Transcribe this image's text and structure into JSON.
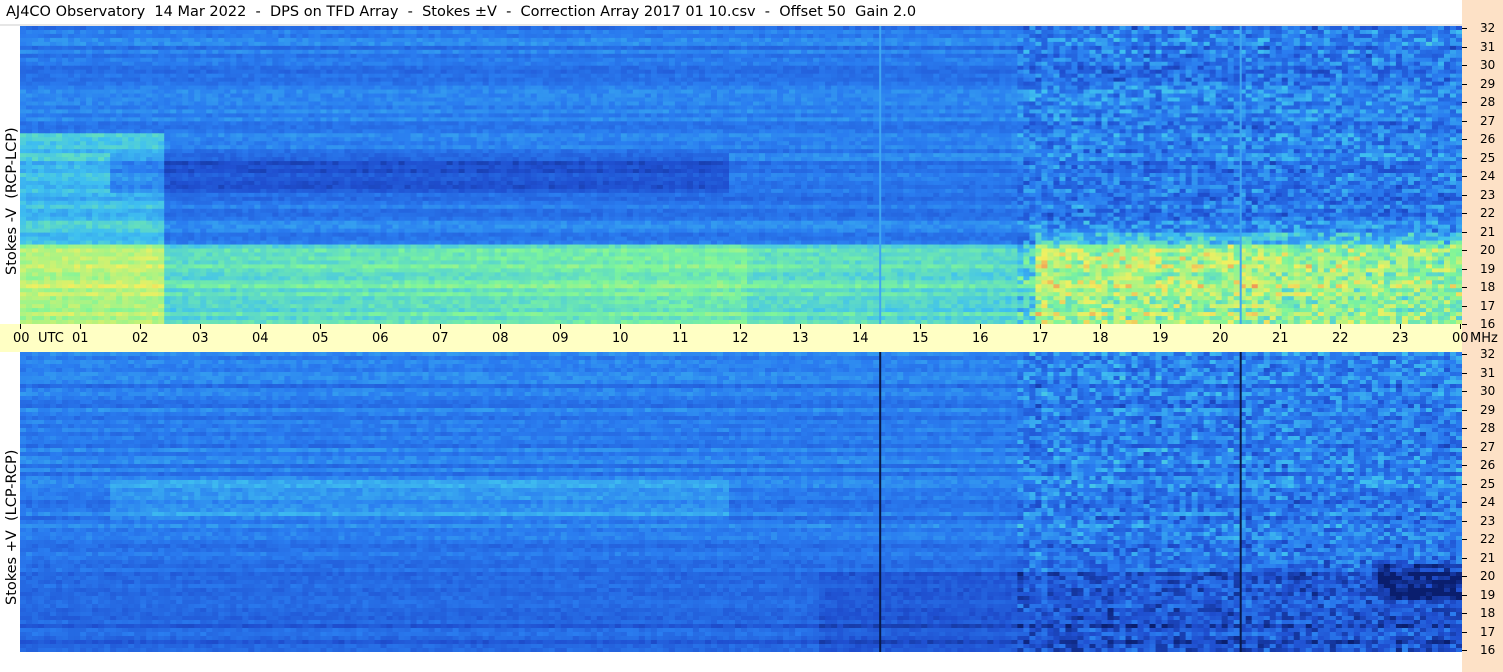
{
  "title": "AJ4CO Observatory  14 Mar 2022  -  DPS on TFD Array  -  Stokes ±V  -  Correction Array 2017 01 10.csv  -  Offset 50  Gain 2.0",
  "chart_data": [
    {
      "type": "heatmap",
      "panel": "top",
      "ylabel": "Stokes -V  (RCP-LCP)",
      "xlabel": "UTC",
      "x_unit": "UTC",
      "y_unit": "MHz",
      "ylim": [
        16,
        32
      ],
      "xlim": [
        0,
        24
      ],
      "colormap": [
        "#0a1e6e",
        "#1f4fd0",
        "#2a7df0",
        "#3fc0f0",
        "#7ef59a",
        "#f0f060",
        "#f06050"
      ]
    },
    {
      "type": "heatmap",
      "panel": "bottom",
      "ylabel": "Stokes +V  (LCP-RCP)",
      "xlabel": "UTC",
      "x_unit": "UTC",
      "y_unit": "MHz",
      "ylim": [
        16,
        32
      ],
      "xlim": [
        0,
        24
      ],
      "colormap": [
        "#0a1e6e",
        "#1f4fd0",
        "#2a7df0",
        "#3fc0f0",
        "#7ef59a",
        "#f0f060",
        "#f06050"
      ]
    }
  ],
  "time_axis": {
    "labels": [
      "00",
      "01",
      "02",
      "03",
      "04",
      "05",
      "06",
      "07",
      "08",
      "09",
      "10",
      "11",
      "12",
      "13",
      "14",
      "15",
      "16",
      "17",
      "18",
      "19",
      "20",
      "21",
      "22",
      "23",
      "00"
    ],
    "unit_left": "UTC",
    "unit_right": "MHz"
  },
  "freq_axis": {
    "labels": [
      "32",
      "31",
      "30",
      "29",
      "28",
      "27",
      "26",
      "25",
      "24",
      "23",
      "22",
      "21",
      "20",
      "19",
      "18",
      "17",
      "16"
    ]
  }
}
